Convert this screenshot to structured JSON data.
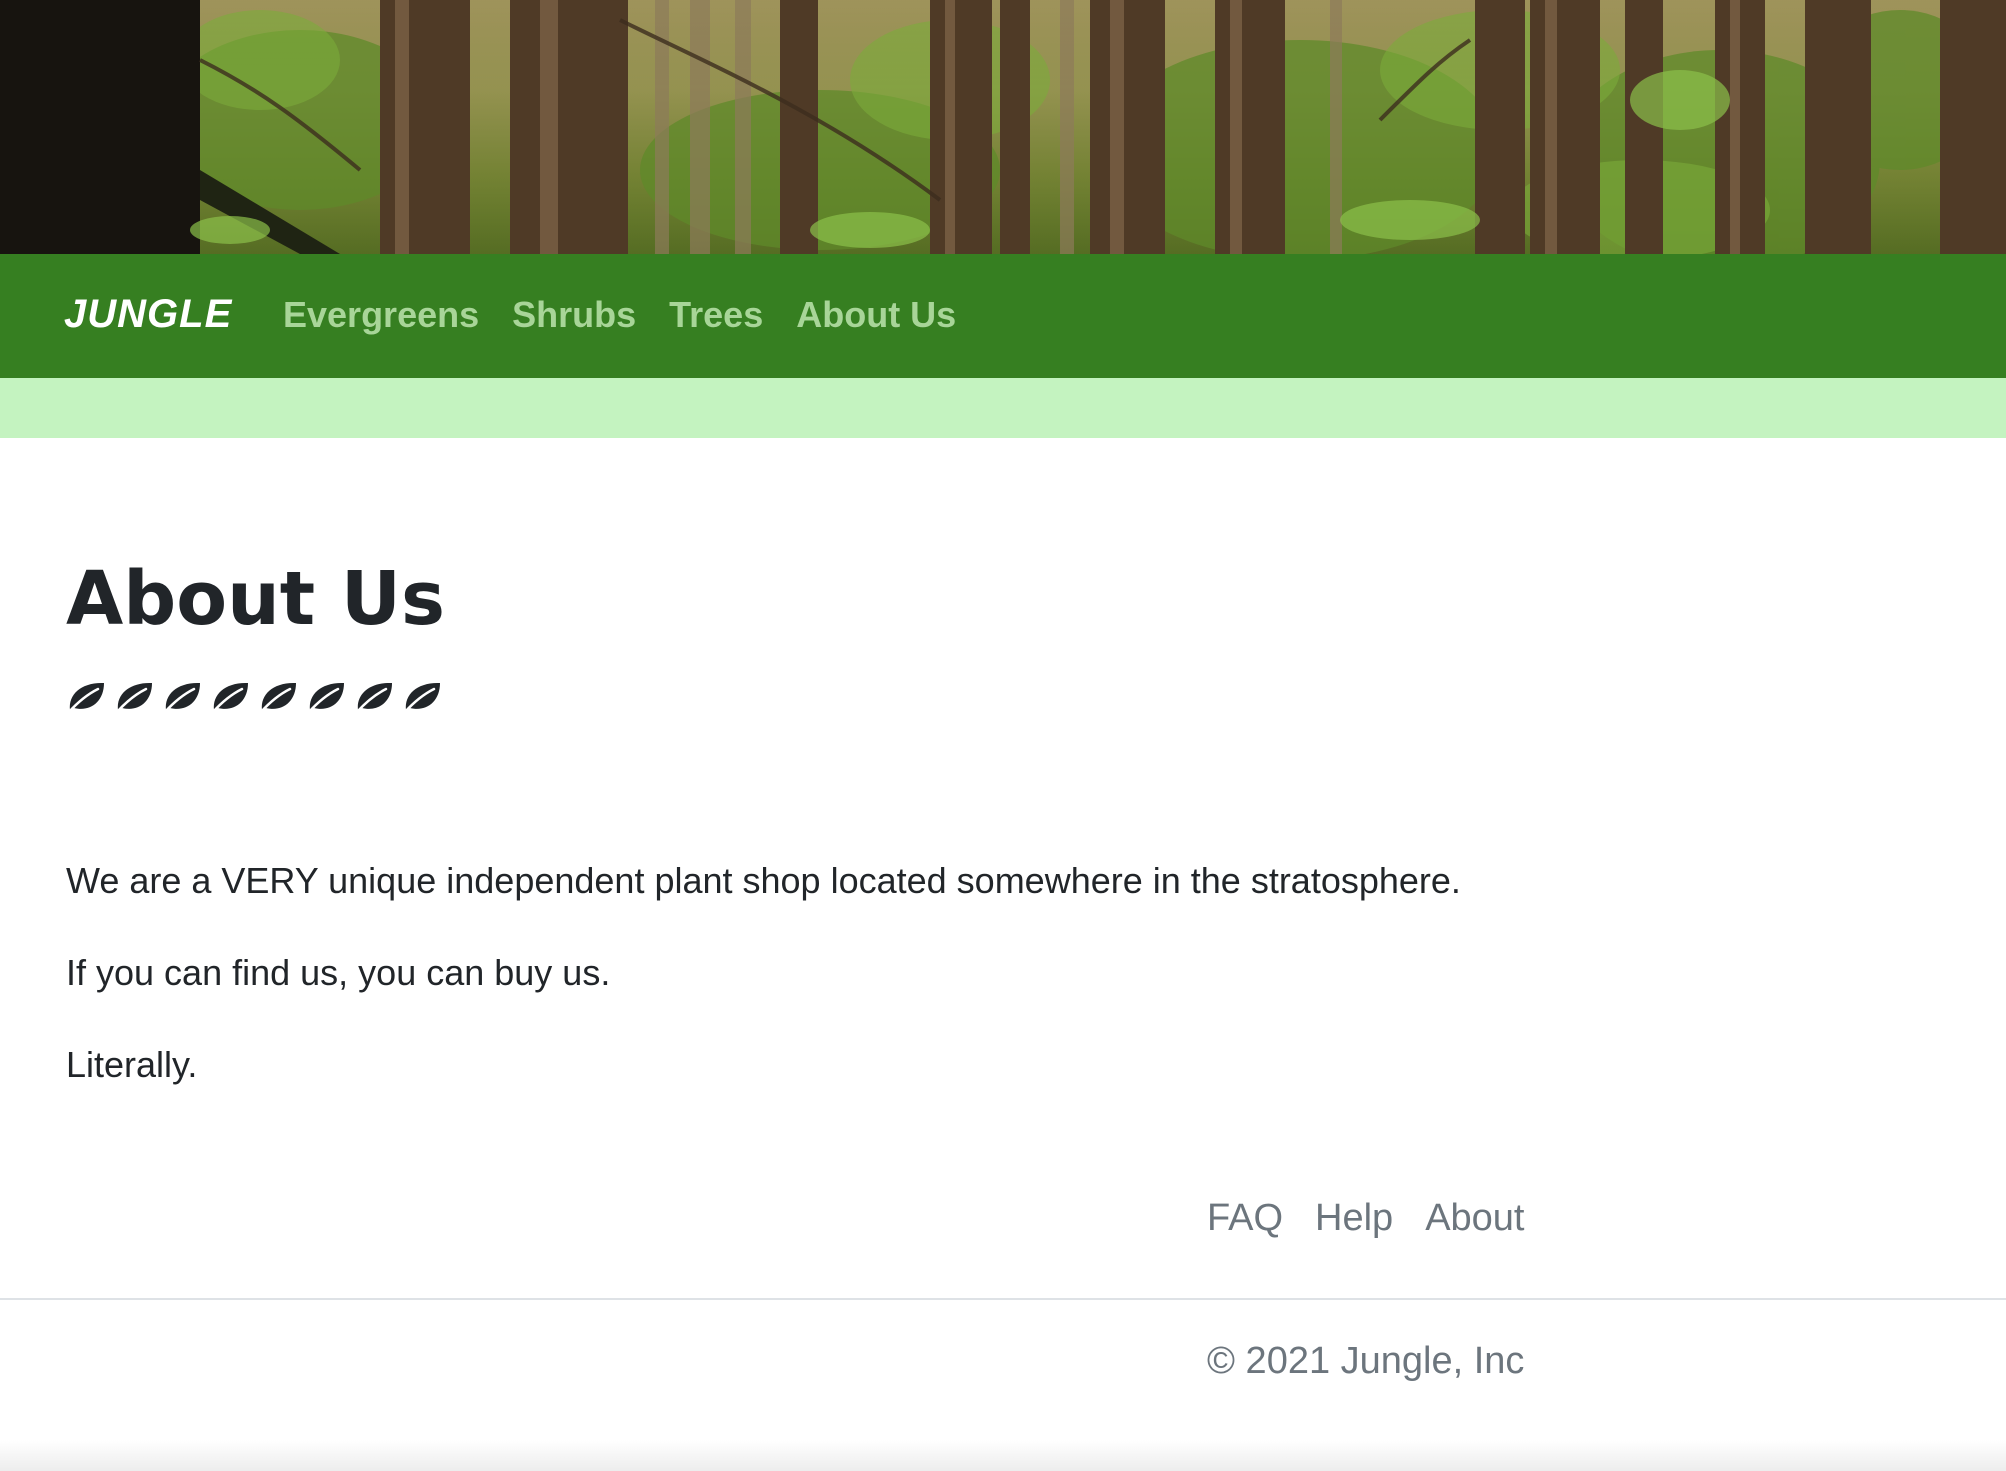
{
  "header": {
    "brand": "JUNGLE",
    "nav": [
      {
        "label": "Evergreens"
      },
      {
        "label": "Shrubs"
      },
      {
        "label": "Trees"
      },
      {
        "label": "About Us"
      }
    ]
  },
  "main": {
    "title": "About Us",
    "leaf_icon": "leaf-icon",
    "leaf_count": 8,
    "paragraphs": [
      "We are a VERY unique independent plant shop located somewhere in the stratosphere.",
      "If you can find us, you can buy us.",
      "Literally."
    ]
  },
  "footer": {
    "links": [
      {
        "label": "FAQ"
      },
      {
        "label": "Help"
      },
      {
        "label": "About"
      }
    ],
    "copyright": "© 2021 Jungle, Inc"
  },
  "colors": {
    "navbar": "#367f21",
    "nav_link": "#a8d598",
    "subbar": "#c4f3c0",
    "text": "#212529",
    "muted": "#6c757d"
  }
}
